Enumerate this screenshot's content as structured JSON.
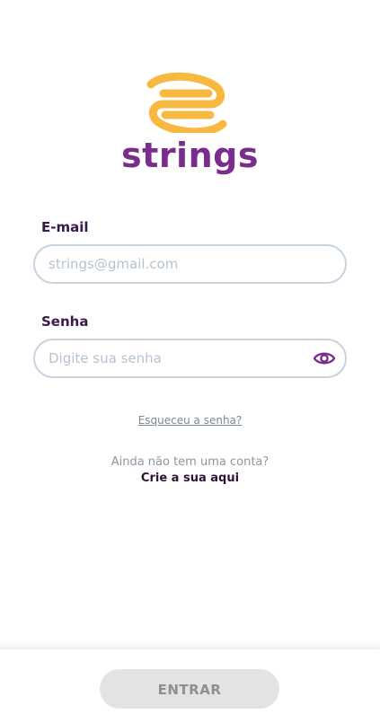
{
  "brand": {
    "logo_text": "strings",
    "logo_icon": "strings-logo-icon",
    "colors": {
      "primary": "#7b2d8e",
      "accent": "#f8b940"
    }
  },
  "form": {
    "email": {
      "label": "E-mail",
      "placeholder": "strings@gmail.com",
      "value": ""
    },
    "password": {
      "label": "Senha",
      "placeholder": "Digite sua senha",
      "value": "",
      "toggle_icon": "eye-icon"
    }
  },
  "links": {
    "forgot_password": "Esqueceu a senha?",
    "no_account": "Ainda não tem uma conta?",
    "create_account": "Crie a sua aqui"
  },
  "footer": {
    "enter_label": "ENTRAR"
  }
}
